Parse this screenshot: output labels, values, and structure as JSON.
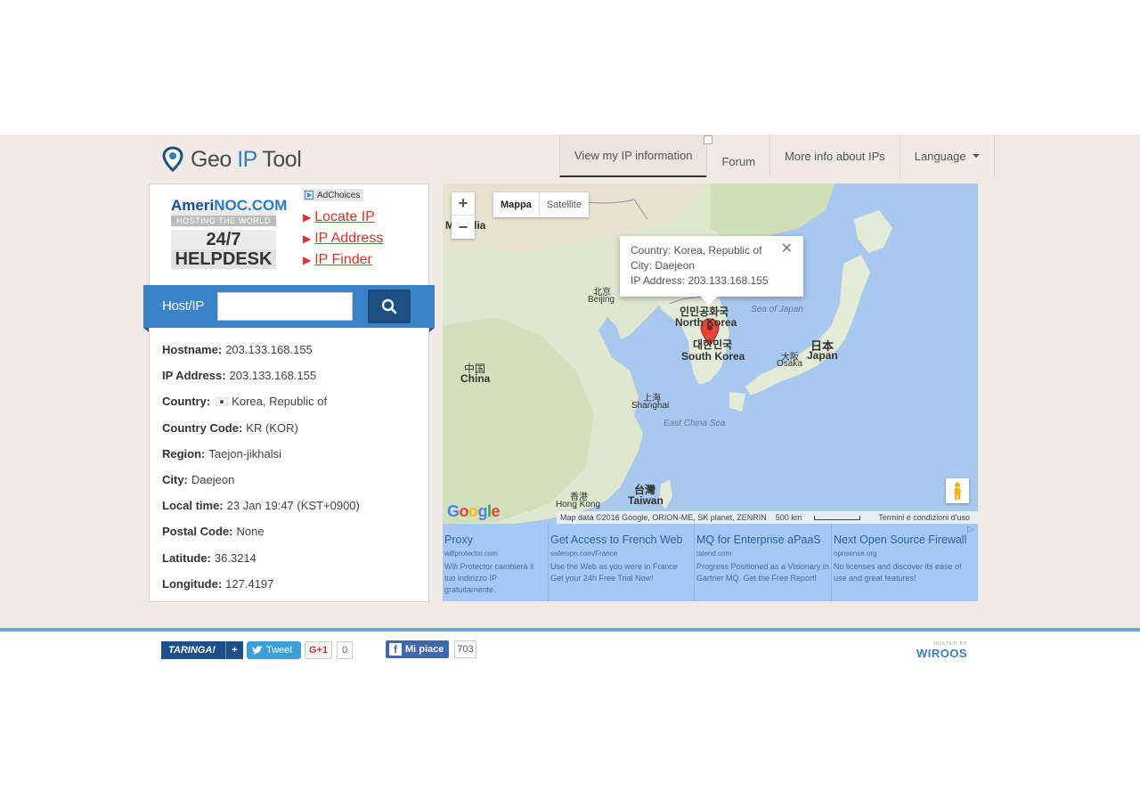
{
  "header": {
    "logo_prefix": "Geo",
    "logo_ip": "IP",
    "logo_suffix": "Tool",
    "nav": [
      {
        "label": "View my IP information"
      },
      {
        "label": "Forum"
      },
      {
        "label": "More info about IPs"
      },
      {
        "label": "Language"
      }
    ]
  },
  "ad": {
    "brand_a": "Ameri",
    "brand_b": "NOC.COM",
    "tagline": "HOSTING THE WORLD",
    "help_line1": "24/7",
    "help_line2": "HELPDESK",
    "adchoices": "AdChoices",
    "links": [
      "Locate IP",
      "IP Address",
      "IP Finder"
    ]
  },
  "hostbar": {
    "label": "Host/IP",
    "input_value": "",
    "button_icon": "search-icon"
  },
  "info": [
    {
      "key": "Hostname:",
      "value": "203.133.168.155"
    },
    {
      "key": "IP Address:",
      "value": "203.133.168.155"
    },
    {
      "key": "Country:",
      "value": "Korea, Republic of"
    },
    {
      "key": "Country Code:",
      "value": "KR (KOR)"
    },
    {
      "key": "Region:",
      "value": "Taejon-jikhalsi"
    },
    {
      "key": "City:",
      "value": "Daejeon"
    },
    {
      "key": "Local time:",
      "value": "23 Jan 19:47 (KST+0900)"
    },
    {
      "key": "Postal Code:",
      "value": "None"
    },
    {
      "key": "Latitude:",
      "value": "36.3214"
    },
    {
      "key": "Longitude:",
      "value": "127.4197"
    }
  ],
  "map": {
    "zoom_in": "+",
    "zoom_out": "−",
    "type_map": "Mappa",
    "type_satellite": "Satellite",
    "popup_line1": "Country: Korea, Republic of",
    "popup_line2": "City: Daejeon",
    "popup_line3": "IP Address: 203.133.168.155",
    "popup_close": "✕",
    "labels": {
      "mongolia_a": "Monolia",
      "beijing_cn": "北京",
      "beijing": "Beijing",
      "china_cn": "中国",
      "china": "China",
      "nk_kr": "인민공화국",
      "nk": "North Korea",
      "sk_kr": "대한민국",
      "sk": "South Korea",
      "sea_japan": "Sea of Japan",
      "japan_cn": "日本",
      "japan": "Japan",
      "osaka_cn": "大阪",
      "osaka": "Osaka",
      "shanghai_cn": "上海",
      "shanghai": "Shanghai",
      "ecs": "East China Sea",
      "hk_cn": "香港",
      "hk": "Hong Kong",
      "taiwan_cn": "台灣",
      "taiwan": "Taiwan"
    },
    "google": "Google",
    "attribution": "Map data ©2016 Google, ORION-ME, SK planet, ZENRIN",
    "scale": "500 km",
    "terms": "Termini e condizioni d'uso"
  },
  "ads_row": [
    {
      "title": "Proxy",
      "url": "wifiprotector.com",
      "desc": "Wifi Protector cambierà il tuo indirizzo IP gratuitamente."
    },
    {
      "title": "Get Access to French Web",
      "url": "safervpn.com/France",
      "desc": "Use the Web as you were in France Get your 24h Free Trial Now!"
    },
    {
      "title": "MQ for Enterprise aPaaS",
      "url": "talend.com",
      "desc": "Progress Positioned as a Visionary in Gartner MQ. Get the Free Report!"
    },
    {
      "title": "Next Open Source Firewall",
      "url": "opnsense.org",
      "desc": "No licenses and discover its ease of use and great features!"
    }
  ],
  "footer": {
    "taringa": "TARINGA!",
    "taringa_plus": "+",
    "tweet": "Tweet",
    "gplus": "G+1",
    "gplus_count": "0",
    "fb_like": "Mi piace",
    "fb_count": "703",
    "host_small": "HOSTED BY",
    "host_brand": "WIROOS"
  }
}
